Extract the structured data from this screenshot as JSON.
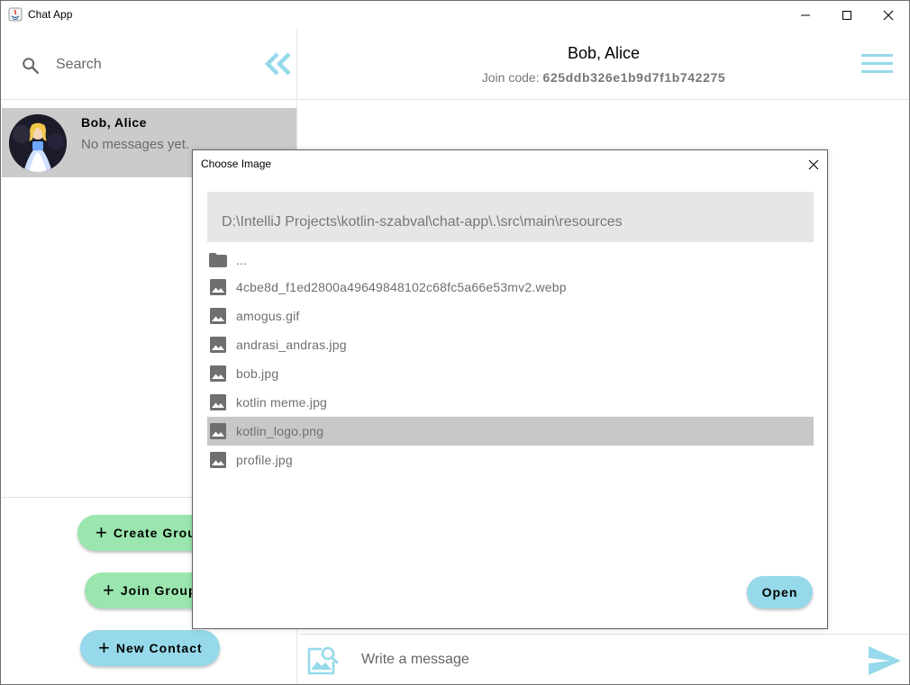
{
  "window": {
    "title": "Chat App"
  },
  "sidebar": {
    "search": {
      "placeholder": "Search"
    },
    "chats": [
      {
        "name": "Bob, Alice",
        "last_message": "No messages yet."
      }
    ],
    "buttons": {
      "create_group": "Create Group",
      "join_group": "Join Group",
      "new_contact": "New Contact"
    }
  },
  "chat": {
    "title": "Bob, Alice",
    "join_code_label": "Join code:",
    "join_code": "625ddb326e1b9d7f1b742275",
    "composer": {
      "placeholder": "Write a message"
    }
  },
  "dialog": {
    "title": "Choose Image",
    "path": "D:\\IntelliJ Projects\\kotlin-szabval\\chat-app\\.\\src\\main\\resources",
    "files": [
      {
        "name": "...",
        "icon": "folder-icon"
      },
      {
        "name": "4cbe8d_f1ed2800a49649848102c68fc5a66e53mv2.webp",
        "icon": "image-icon"
      },
      {
        "name": "amogus.gif",
        "icon": "image-icon"
      },
      {
        "name": "andrasi_andras.jpg",
        "icon": "image-icon"
      },
      {
        "name": "bob.jpg",
        "icon": "image-icon"
      },
      {
        "name": "kotlin meme.jpg",
        "icon": "image-icon"
      },
      {
        "name": "kotlin_logo.png",
        "icon": "image-icon",
        "selected": true
      },
      {
        "name": "profile.jpg",
        "icon": "image-icon"
      }
    ],
    "open_label": "Open"
  },
  "colors": {
    "green_button": "#9ae6ae",
    "blue_accent": "#96d9ea",
    "selected_row": "#c8c8c8",
    "path_bar": "#e6e6e6"
  }
}
